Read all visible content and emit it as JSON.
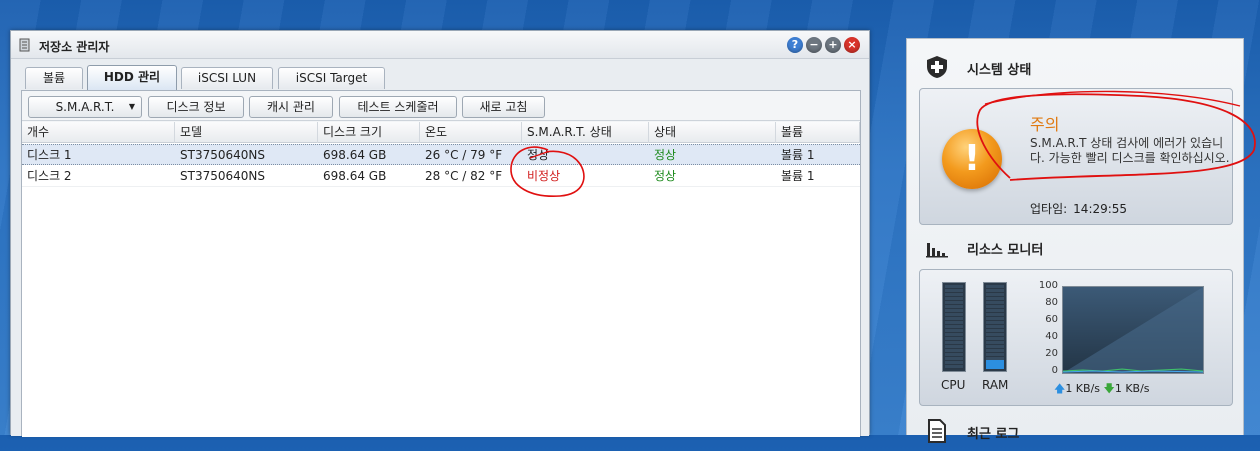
{
  "window": {
    "title": "저장소 관리자",
    "buttons": {
      "help": "?",
      "min": "−",
      "max": "+",
      "close": "×"
    }
  },
  "tabs": [
    {
      "label": "볼륨",
      "active": false
    },
    {
      "label": "HDD 관리",
      "active": true
    },
    {
      "label": "iSCSI LUN",
      "active": false
    },
    {
      "label": "iSCSI Target",
      "active": false
    }
  ],
  "toolbar": {
    "smart": "S.M.A.R.T.",
    "disk_info": "디스크 정보",
    "cache": "캐시 관리",
    "test_schedule": "테스트 스케줄러",
    "refresh": "새로 고침"
  },
  "grid": {
    "columns": [
      "개수",
      "모델",
      "디스크 크기",
      "온도",
      "S.M.A.R.T. 상태",
      "상태",
      "볼륨"
    ],
    "rows": [
      {
        "name": "디스크 1",
        "model": "ST3750640NS",
        "size": "698.64 GB",
        "temp": "26 °C / 79 °F",
        "smart": "정상",
        "smart_ok": true,
        "status": "정상",
        "volume": "볼륨 1",
        "selected": true
      },
      {
        "name": "디스크 2",
        "model": "ST3750640NS",
        "size": "698.64 GB",
        "temp": "28 °C / 82 °F",
        "smart": "비정상",
        "smart_ok": false,
        "status": "정상",
        "volume": "볼륨 1",
        "selected": false
      }
    ]
  },
  "system_status": {
    "heading": "시스템 상태",
    "warning_title": "주의",
    "warning_message": "S.M.A.R.T 상태 검사에 에러가 있습니다. 가능한 빨리 디스크를 확인하십시오.",
    "uptime_label": "업타임:",
    "uptime_value": "14:29:55"
  },
  "resource_monitor": {
    "heading": "리소스 모니터",
    "cpu_label": "CPU",
    "ram_label": "RAM",
    "cpu_usage_pct": 0,
    "ram_usage_pct": 10,
    "y_ticks": [
      "100",
      "80",
      "60",
      "40",
      "20",
      "0"
    ],
    "upload": "1 KB/s",
    "download": "1 KB/s"
  },
  "recent_log": {
    "heading": "최근 로그"
  },
  "colors": {
    "good": "#1d8a1d",
    "bad": "#d11c1c",
    "warning": "#e07a12",
    "annotation": "#e01010"
  }
}
